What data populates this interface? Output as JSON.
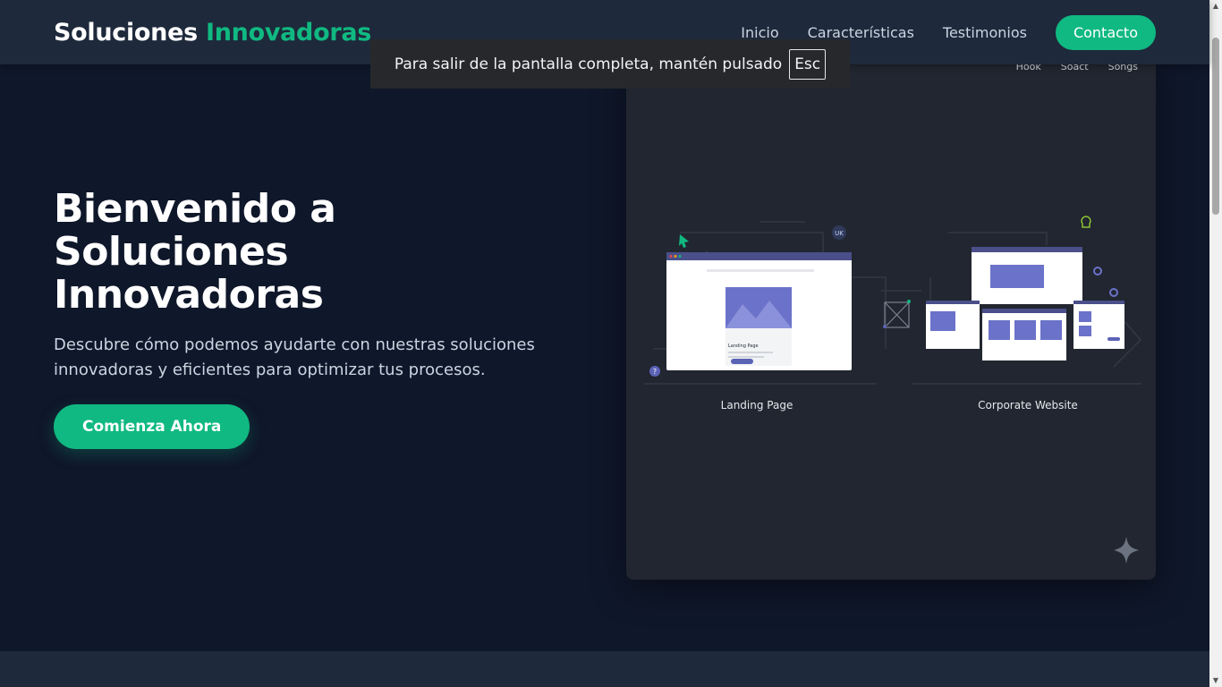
{
  "header": {
    "brand_main": "Soluciones",
    "brand_accent": "Innovadoras",
    "nav": [
      "Inicio",
      "Características",
      "Testimonios"
    ],
    "cta": "Contacto"
  },
  "hero": {
    "title_line1": "Bienvenido a",
    "title_line2": "Soluciones",
    "title_line3": "Innovadoras",
    "subtitle": "Descubre cómo podemos ayudarte con nuestras soluciones innovadoras y eficientes para optimizar tus procesos.",
    "button": "Comienza Ahora"
  },
  "card": {
    "tabs": [
      "Hook",
      "Soact",
      "Songs"
    ],
    "badge": "UK",
    "mockup_title": "Landing Page",
    "captions": [
      "Landing Page",
      "Corporate Website"
    ]
  },
  "toast": {
    "message": "Para salir de la pantalla completa, mantén pulsado",
    "key": "Esc"
  },
  "colors": {
    "accent": "#10b981",
    "background": "#0f172a",
    "header_bg": "#1e293b",
    "card_bg": "#222630",
    "mock_purple": "#5b63b7"
  }
}
